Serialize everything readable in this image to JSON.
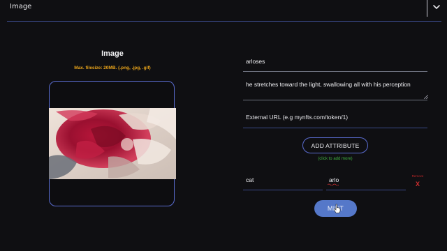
{
  "header": {
    "asset_type_label": "Image",
    "dropdown_icon": "chevron-down-icon"
  },
  "upload": {
    "title": "Image",
    "hint": "Max. filesize: 20MB. (.png, .jpg, .gif)"
  },
  "form": {
    "name_value": "arloses",
    "description_value": "he stretches toward the light, swallowing all with his perception",
    "external_url_placeholder": "External URL (e.g mynfts.com/token/1)",
    "add_attribute_label": "ADD ATTRIBUTE",
    "add_attribute_hint": "(click to add more)",
    "attributes": [
      {
        "trait_type": "cat",
        "value": "arlo",
        "remove_label": "Remove",
        "remove_symbol": "X"
      }
    ],
    "mint_label": "MINT"
  },
  "colors": {
    "background": "#0f0f12",
    "accent": "#5a6cd0",
    "hint_orange": "#e8a31a",
    "hint_green": "#3fae3f",
    "danger": "#d32f2f",
    "mint_button": "#5578c9"
  }
}
